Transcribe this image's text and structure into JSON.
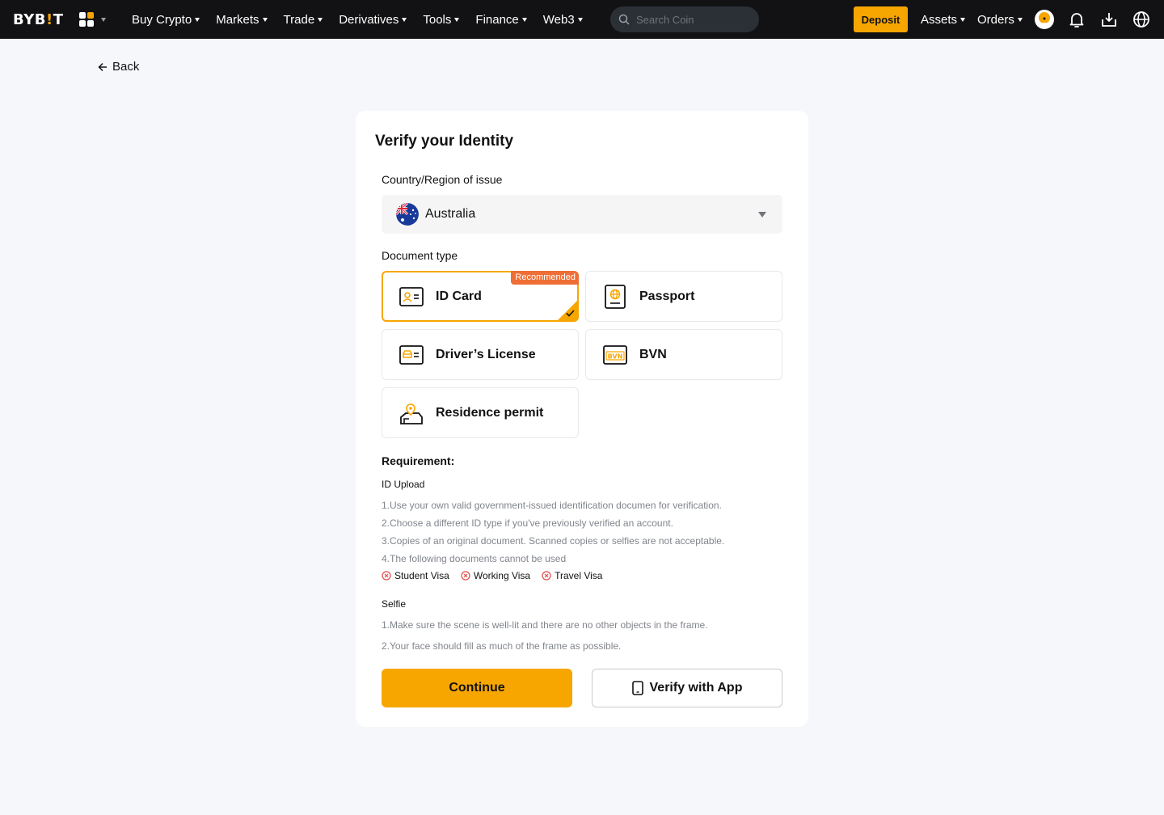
{
  "nav": {
    "logo_left": "BYB",
    "logo_bang": "!",
    "logo_right": "T",
    "items": [
      "Buy Crypto",
      "Markets",
      "Trade",
      "Derivatives",
      "Tools",
      "Finance",
      "Web3"
    ],
    "search_placeholder": "Search Coin",
    "deposit": "Deposit",
    "assets": "Assets",
    "orders": "Orders",
    "icons": [
      "apps-grid-icon",
      "search-icon",
      "avatar",
      "bell-icon",
      "download-icon",
      "globe-icon"
    ],
    "colors": {
      "accent": "#f7a600",
      "bar": "#121214"
    }
  },
  "back": {
    "label": "Back"
  },
  "form": {
    "title": "Verify your Identity",
    "country_label": "Country/Region of issue",
    "country_value": "Australia",
    "doc_type_label": "Document type",
    "docs": [
      {
        "label": "ID Card",
        "badge": "Recommended",
        "selected": true,
        "icon": "id-card-icon"
      },
      {
        "label": "Passport",
        "selected": false,
        "icon": "passport-icon"
      },
      {
        "label": "Driver’s License",
        "selected": false,
        "icon": "drivers-license-icon"
      },
      {
        "label": "BVN",
        "selected": false,
        "icon": "bvn-icon"
      },
      {
        "label": "Residence permit",
        "selected": false,
        "icon": "residence-permit-icon"
      }
    ],
    "requirement": {
      "title": "Requirement:",
      "id_upload_title": "ID Upload",
      "id_lines": [
        "1.Use your own valid government-issued identification documen for verification.",
        "2.Choose a different ID type if you've previously verified an account.",
        "3.Copies of an original document. Scanned copies or selfies are not acceptable.",
        "4.The following documents cannot be used"
      ],
      "excluded": [
        "Student Visa",
        "Working Visa",
        "Travel Visa"
      ],
      "selfie_title": "Selfie",
      "selfie_lines": [
        "1.Make sure the scene is well-lit and there are no other objects in the frame.",
        "2.Your face should fill as much of the frame as possible."
      ]
    },
    "continue_label": "Continue",
    "verify_app_label": "Verify with App"
  }
}
